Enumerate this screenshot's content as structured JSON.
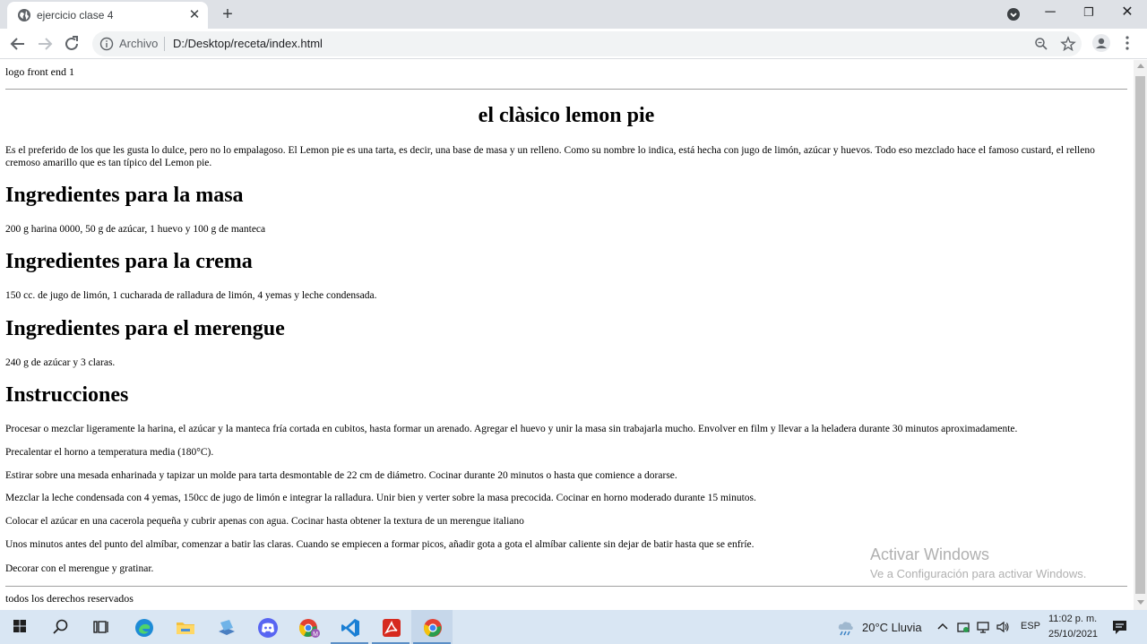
{
  "browser": {
    "tab_title": "ejercicio clase 4",
    "address_prefix": "Archivo",
    "address_url": "D:/Desktop/receta/index.html"
  },
  "page": {
    "logo": "logo front end 1",
    "title": "el clàsico lemon pie",
    "intro": "Es el preferido de los que les gusta lo dulce, pero no lo empalagoso. El Lemon pie es una tarta, es decir, una base de masa y un relleno. Como su nombre lo indica, está hecha con jugo de limón, azúcar y huevos. Todo eso mezclado hace el famoso custard, el relleno cremoso amarillo que es tan típico del Lemon pie.",
    "sections": [
      {
        "heading": "Ingredientes para la masa",
        "text": "200 g harina 0000, 50 g de azúcar, 1 huevo y 100 g de manteca"
      },
      {
        "heading": "Ingredientes para la crema",
        "text": "150 cc. de jugo de limón, 1 cucharada de ralladura de limón, 4 yemas y leche condensada."
      },
      {
        "heading": "Ingredientes para el merengue",
        "text": "240 g de azúcar y 3 claras."
      }
    ],
    "instructions_heading": "Instrucciones",
    "instructions": [
      "Procesar o mezclar ligeramente la harina, el azúcar y la manteca fría cortada en cubitos, hasta formar un arenado. Agregar el huevo y unir la masa sin trabajarla mucho. Envolver en film y llevar a la heladera durante 30 minutos aproximadamente.",
      "Precalentar el horno a temperatura media (180°C).",
      "Estirar sobre una mesada enharinada y tapizar un molde para tarta desmontable de 22 cm de diámetro. Cocinar durante 20 minutos o hasta que comience a dorarse.",
      "Mezclar la leche condensada con 4 yemas, 150cc de jugo de limón e integrar la ralladura. Unir bien y verter sobre la masa precocida. Cocinar en horno moderado durante 15 minutos.",
      "Colocar el azúcar en una cacerola pequeña y cubrir apenas con agua. Cocinar hasta obtener la textura de un merengue italiano",
      "Unos minutos antes del punto del almíbar, comenzar a batir las claras. Cuando se empiecen a formar picos, añadir gota a gota el almíbar caliente sin dejar de batir hasta que se enfríe.",
      "Decorar con el merengue y gratinar."
    ],
    "footer": "todos los derechos reservados"
  },
  "watermark": {
    "line1": "Activar Windows",
    "line2": "Ve a Configuración para activar Windows."
  },
  "taskbar": {
    "weather": "20°C  Lluvia",
    "language": "ESP",
    "time": "11:02 p. m.",
    "date": "25/10/2021"
  },
  "colors": {
    "tabstrip": "#dee1e6",
    "taskbar": "#d9e6f3",
    "omnibox": "#f1f3f4"
  }
}
